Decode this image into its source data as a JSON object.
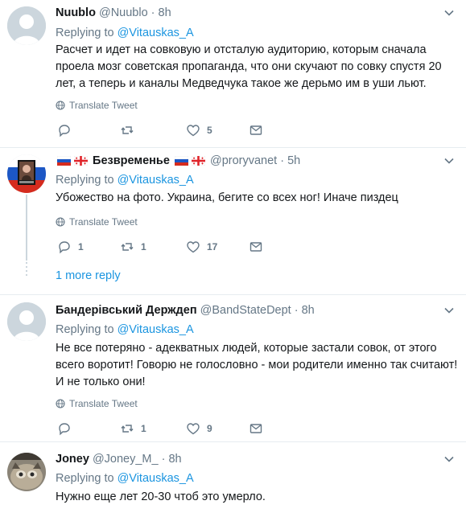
{
  "tweets": [
    {
      "name": "Nuublo",
      "handle": "@Nuublo",
      "dot": "·",
      "time": "8h",
      "replying_label": "Replying to",
      "replying_to": "@Vitauskas_A",
      "text": "Расчет и идет на совковую и  отсталую аудиторию, которым сначала проела мозг советская пропаганда, что они скучают по совку спустя 20 лет, а теперь и каналы Медведчука такое же дерьмо им в уши льют.",
      "translate": "Translate Tweet",
      "replies": "",
      "retweets": "",
      "likes": "5"
    },
    {
      "name": "Безвременье",
      "handle": "@proryvanet",
      "dot": "·",
      "time": "5h",
      "replying_label": "Replying to",
      "replying_to": "@Vitauskas_A",
      "text": "Убожество на фото. Украина, бегите со всех ног! Иначе пиздец",
      "translate": "Translate Tweet",
      "replies": "1",
      "retweets": "1",
      "likes": "17",
      "more_replies": "1 more reply"
    },
    {
      "name": "Бандерівський Держдеп",
      "handle": "@BandStateDept",
      "dot": "·",
      "time": "8h",
      "replying_label": "Replying to",
      "replying_to": "@Vitauskas_A",
      "text": "Не все потеряно - адекватных людей, которые застали совок, от этого всего воротит! Говорю не голословно - мои родители именно так считают! И не только они!",
      "translate": "Translate Tweet",
      "replies": "",
      "retweets": "1",
      "likes": "9"
    },
    {
      "name": "Joney",
      "handle": "@Joney_M_",
      "dot": "·",
      "time": "8h",
      "replying_label": "Replying to",
      "replying_to": "@Vitauskas_A",
      "text": "Нужно еще лет 20-30 чтоб это умерло."
    }
  ],
  "colors": {
    "link": "#1b95e0",
    "muted": "#657786",
    "divider": "#e6ecf0"
  },
  "icons": [
    "default-avatar-icon",
    "caret-down-icon",
    "globe-icon",
    "reply-icon",
    "retweet-icon",
    "heart-icon",
    "message-icon",
    "russia-flag-icon",
    "georgia-flag-icon"
  ]
}
